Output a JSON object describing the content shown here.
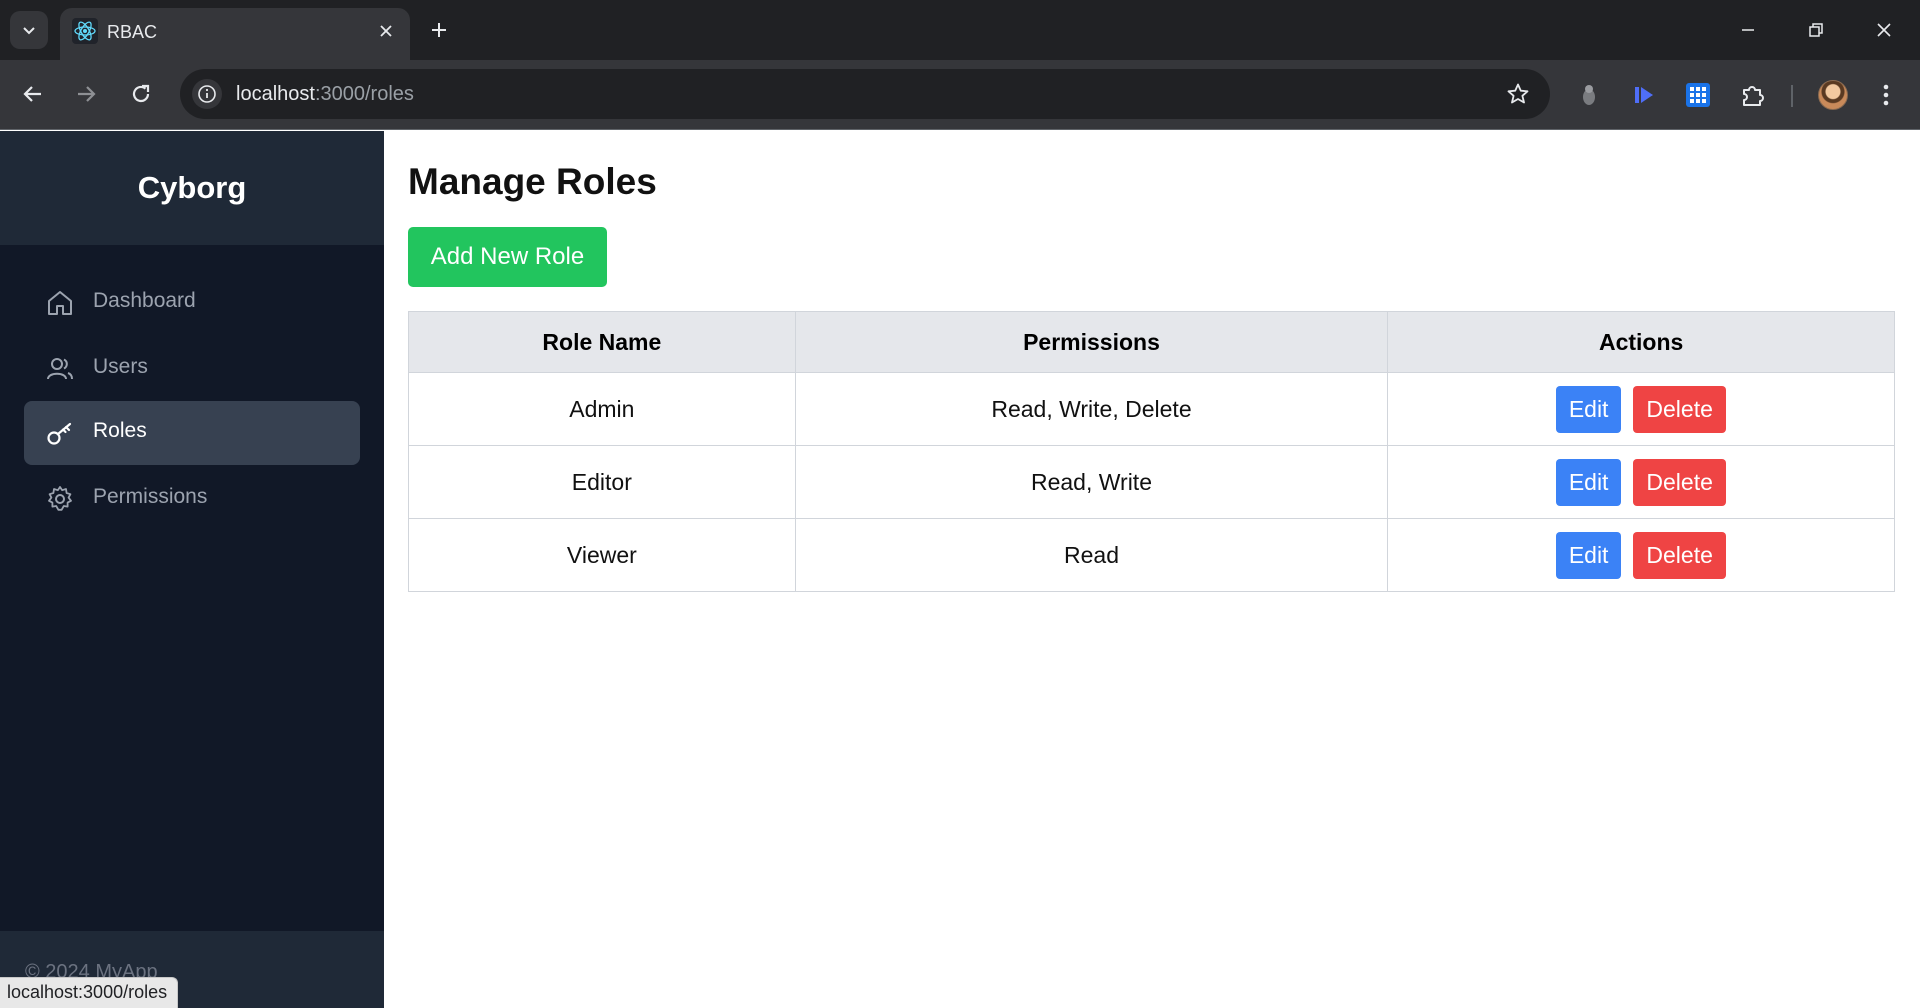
{
  "browser": {
    "tab_title": "RBAC",
    "url_host": "localhost",
    "url_rest": ":3000/roles"
  },
  "sidebar": {
    "brand": "Cyborg",
    "items": [
      {
        "label": "Dashboard",
        "icon": "home-icon",
        "active": false
      },
      {
        "label": "Users",
        "icon": "users-icon",
        "active": false
      },
      {
        "label": "Roles",
        "icon": "key-icon",
        "active": true
      },
      {
        "label": "Permissions",
        "icon": "gear-icon",
        "active": false
      }
    ],
    "footer": "© 2024 MyApp"
  },
  "status_bar": {
    "link_preview": "localhost:3000/roles"
  },
  "main": {
    "title": "Manage Roles",
    "add_button": "Add New Role",
    "table": {
      "headers": [
        "Role Name",
        "Permissions",
        "Actions"
      ],
      "rows": [
        {
          "name": "Admin",
          "permissions": "Read, Write, Delete"
        },
        {
          "name": "Editor",
          "permissions": "Read, Write"
        },
        {
          "name": "Viewer",
          "permissions": "Read"
        }
      ],
      "edit_label": "Edit",
      "delete_label": "Delete"
    }
  },
  "colors": {
    "sidebar_bg": "#111827",
    "sidebar_header_bg": "#1f2937",
    "active_item_bg": "#374151",
    "add_button": "#22c55e",
    "edit_button": "#3b82f6",
    "delete_button": "#ef4444"
  }
}
